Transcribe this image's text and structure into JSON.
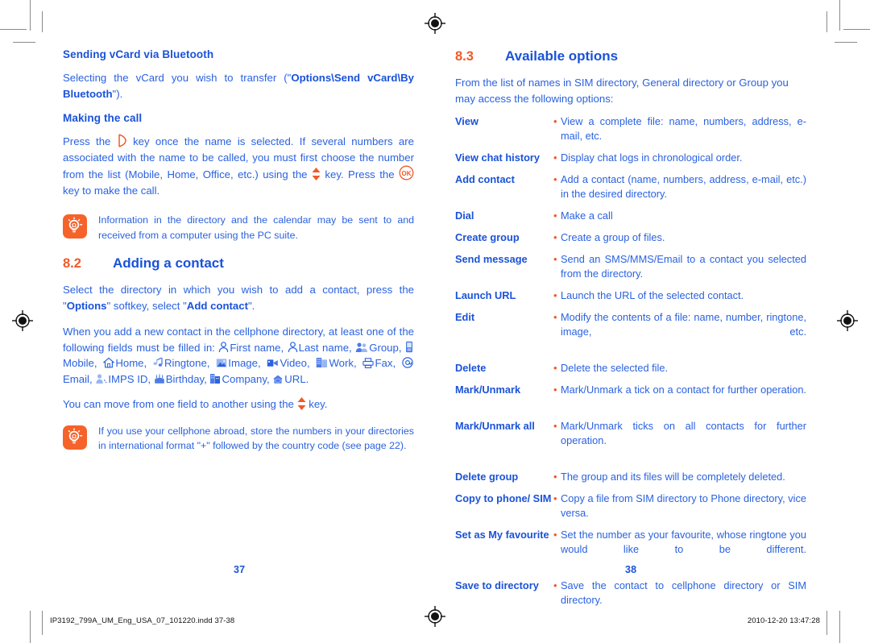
{
  "document": {
    "left_page": {
      "folio": "37",
      "subheads": {
        "sending_vcard": "Sending vCard via Bluetooth",
        "making_the_call": "Making the call"
      },
      "paragraphs": {
        "vcard_pre": "Selecting the vCard you wish to transfer (\"",
        "vcard_bold": "Options\\Send vCard\\By Bluetooth",
        "vcard_post": "\").",
        "call_a": "Press the",
        "call_b": "key once the name is selected. If several numbers are associated with the name to be called, you must first choose the number from the list (Mobile, Home, Office, etc.) using the",
        "call_c": "key. Press the",
        "call_d": "key to make the call.",
        "add_contact_pre": "Select the directory in which you wish to add a contact, press the \"",
        "add_contact_b1": "Options",
        "add_contact_mid": "\" softkey, select \"",
        "add_contact_b2": "Add contact",
        "add_contact_post": "\".",
        "fields_intro": "When you add a new contact in the cellphone directory, at least one of the following fields must be filled in:",
        "move_field_a": "You can move from one field to another using the",
        "move_field_b": "key."
      },
      "section": {
        "number": "8.2",
        "title": "Adding a contact"
      },
      "tips": [
        {
          "icon": "lightbulb-icon",
          "text": "Information in the directory and the calendar may be sent to and received from a computer using the PC suite."
        },
        {
          "icon": "lightbulb-icon",
          "text": "If you use your cellphone abroad, store the numbers in your directories in international format \"+\" followed by the country code (see page 22)."
        }
      ],
      "contact_fields": [
        {
          "icon": "person-icon",
          "label": "First name,"
        },
        {
          "icon": "person-icon",
          "label": "Last name,"
        },
        {
          "icon": "group-icon",
          "label": "Group,"
        },
        {
          "icon": "mobile-icon",
          "label": "Mobile,"
        },
        {
          "icon": "home-icon",
          "label": "Home,"
        },
        {
          "icon": "ringtone-icon",
          "label": "Ringtone,"
        },
        {
          "icon": "image-icon",
          "label": "Image,"
        },
        {
          "icon": "video-icon",
          "label": "Video,"
        },
        {
          "icon": "work-icon",
          "label": "Work,"
        },
        {
          "icon": "fax-icon",
          "label": "Fax,"
        },
        {
          "icon": "email-icon",
          "label": "Email,"
        },
        {
          "icon": "imps-id-icon",
          "label": "IMPS ID,"
        },
        {
          "icon": "birthday-icon",
          "label": "Birthday,"
        },
        {
          "icon": "company-icon",
          "label": "Company,"
        },
        {
          "icon": "url-icon",
          "label": "URL."
        }
      ]
    },
    "right_page": {
      "folio": "38",
      "section": {
        "number": "8.3",
        "title": "Available options"
      },
      "intro": "From the list of names in SIM directory, General directory or Group you may access the following options:",
      "bullet": "•",
      "options": [
        {
          "term": "View",
          "desc": "View a complete file: name, numbers, address, e-mail, etc."
        },
        {
          "term": "View chat history",
          "desc": "Display chat logs in chronological order."
        },
        {
          "term": "Add contact",
          "desc": "Add a contact (name, numbers, address, e-mail, etc.) in the desired directory."
        },
        {
          "term": "Dial",
          "desc": "Make a call"
        },
        {
          "term": "Create group",
          "desc": "Create a group of files."
        },
        {
          "term": "Send message",
          "desc": "Send an SMS/MMS/Email to a contact you selected from the directory."
        },
        {
          "term": "Launch URL",
          "desc": "Launch the URL of the selected contact."
        },
        {
          "term": "Edit",
          "desc": "Modify the contents of a file: name, number, ringtone, image, etc."
        },
        {
          "term": "Delete",
          "desc": "Delete the selected file."
        },
        {
          "term": "Mark/Unmark",
          "desc": "Mark/Unmark a tick on a contact for further operation."
        },
        {
          "term": "Mark/Unmark all",
          "desc": "Mark/Unmark ticks on all contacts for further operation."
        },
        {
          "term": "Delete group",
          "desc": "The group and its files will be completely deleted."
        },
        {
          "term": "Copy to phone/ SIM",
          "desc": "Copy a file from SIM directory to Phone directory, vice versa."
        },
        {
          "term": "Set as My favourite",
          "desc": "Set the number as your favourite, whose ringtone you would like to be different."
        },
        {
          "term": "Save to directory",
          "desc": "Save the contact to cellphone directory or SIM directory."
        }
      ]
    },
    "footer": {
      "filename": "IP3192_799A_UM_Eng_USA_07_101220.indd   37-38",
      "timestamp": "2010-12-20   13:47:28"
    },
    "colors": {
      "heading_blue": "#1a52d8",
      "body_blue": "#2a62e0",
      "accent_orange": "#f05a28",
      "tip_orange": "#f5632a",
      "crop_mark": "#8a8a8a"
    }
  }
}
